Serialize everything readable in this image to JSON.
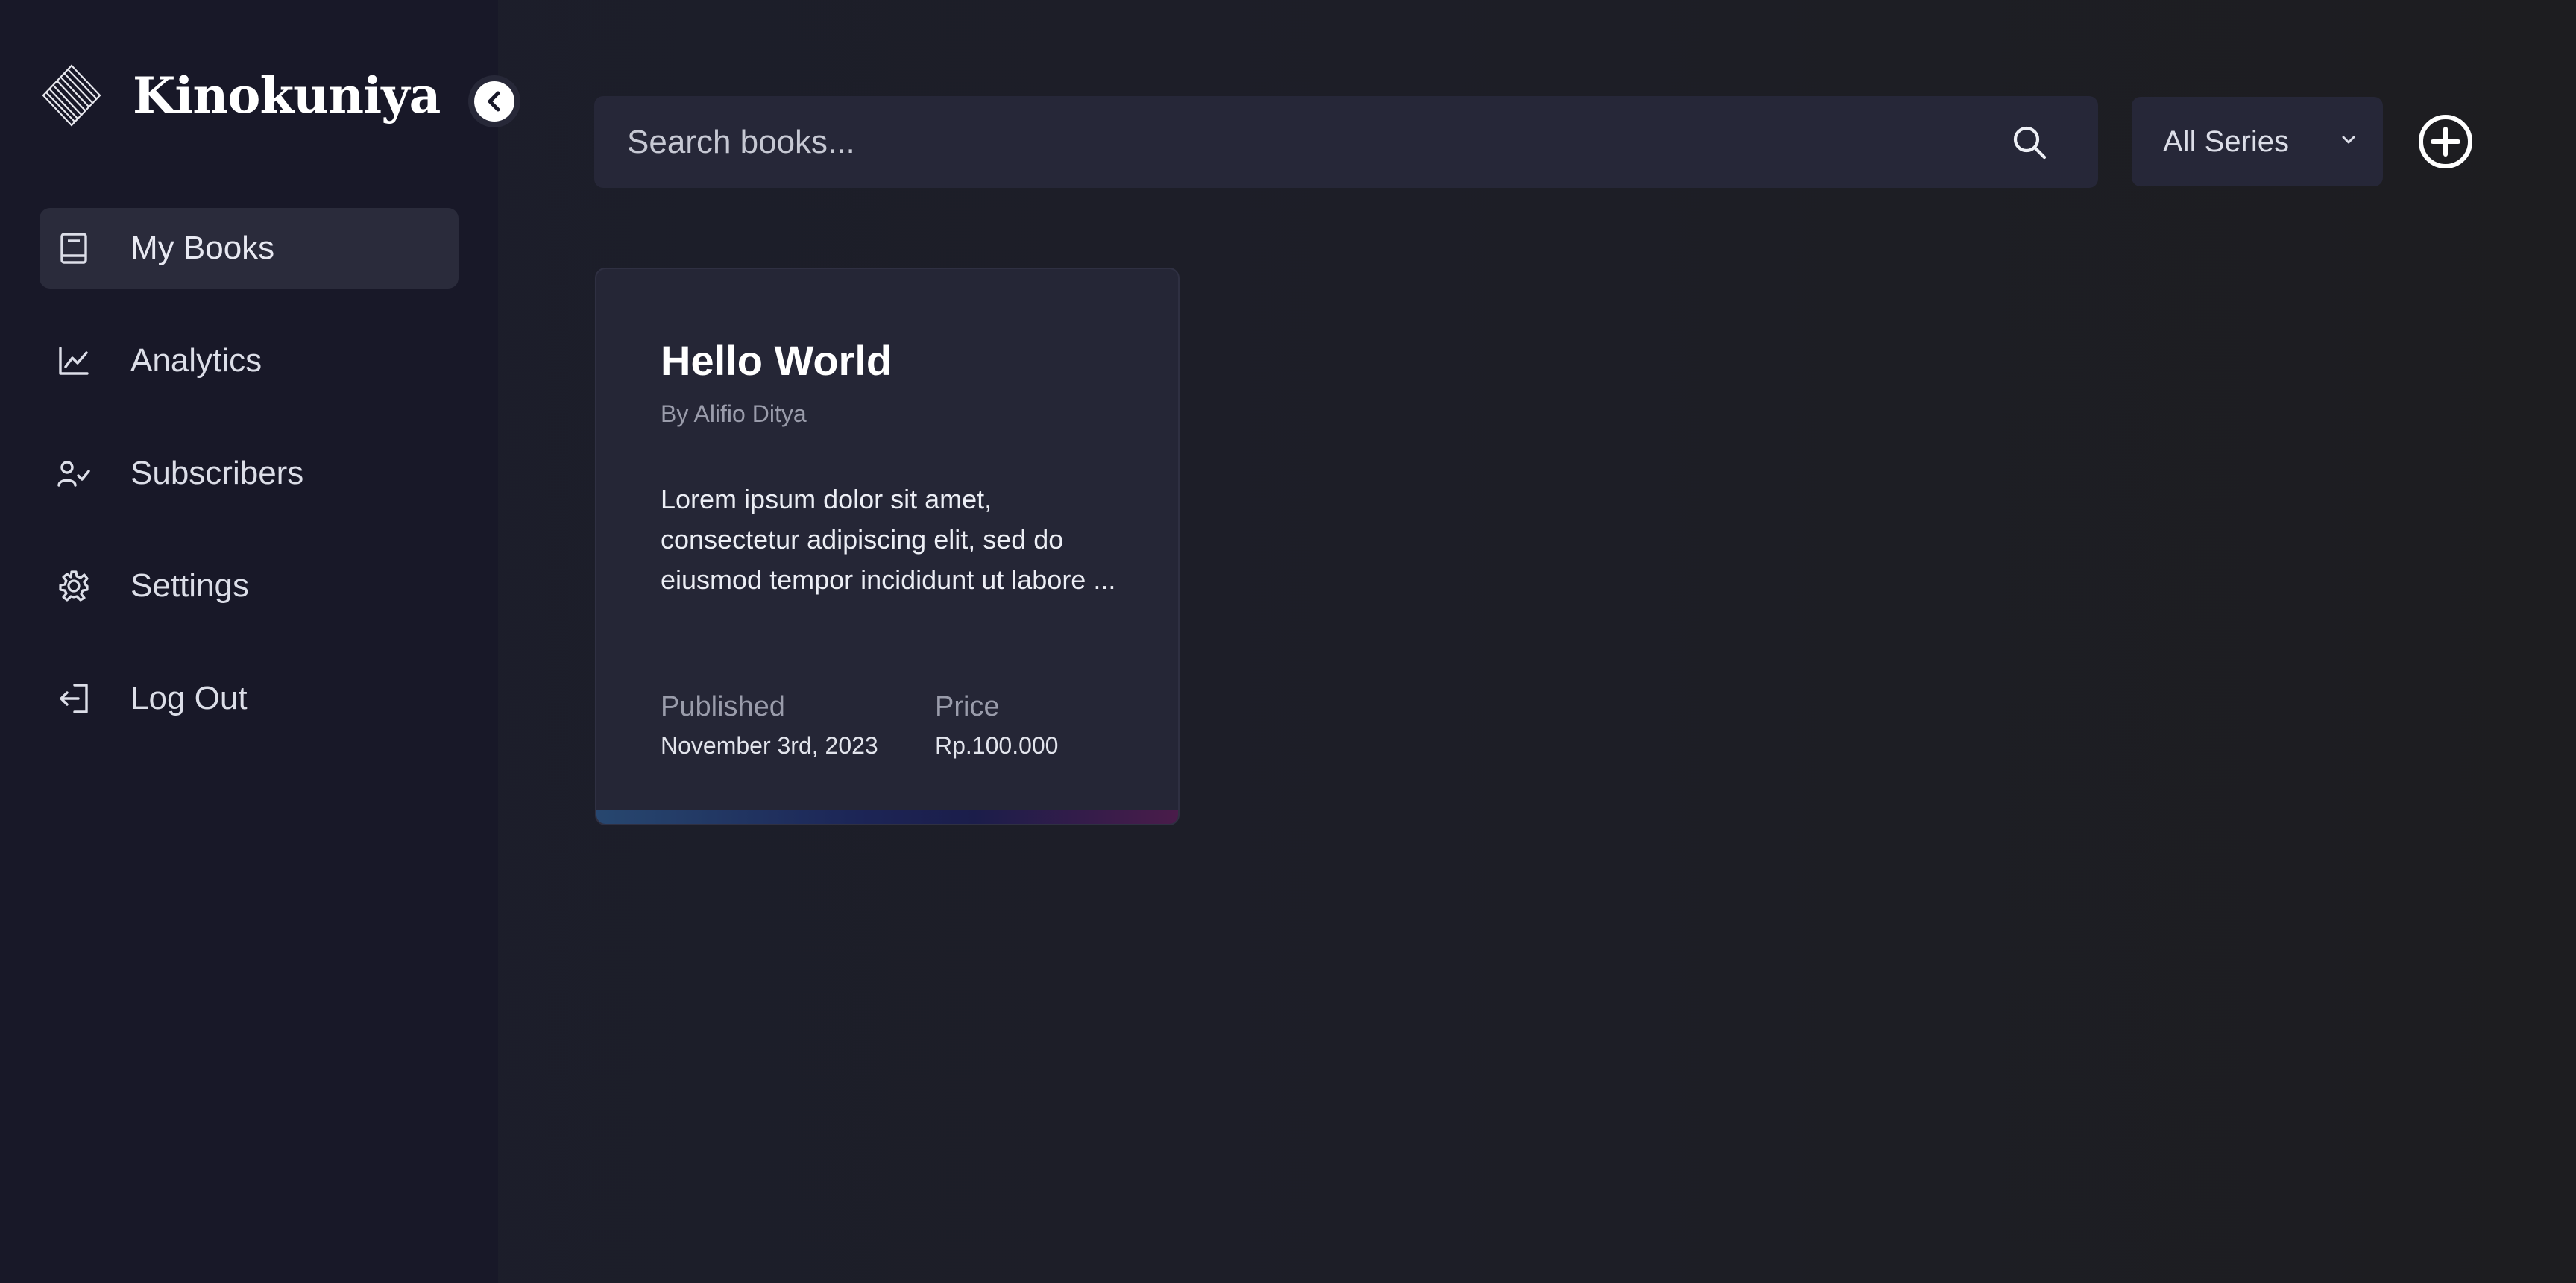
{
  "brand": {
    "name": "Kinokuniya",
    "logo_icon": "striped-diamond-logo"
  },
  "sidebar": {
    "collapse_icon": "chevron-left-icon",
    "items": [
      {
        "label": "My Books",
        "icon": "book-icon",
        "active": true
      },
      {
        "label": "Analytics",
        "icon": "line-chart-icon",
        "active": false
      },
      {
        "label": "Subscribers",
        "icon": "user-check-icon",
        "active": false
      },
      {
        "label": "Settings",
        "icon": "gear-icon",
        "active": false
      },
      {
        "label": "Log Out",
        "icon": "logout-icon",
        "active": false
      }
    ]
  },
  "toolbar": {
    "search_placeholder": "Search books...",
    "search_value": "",
    "series_selected": "All Series",
    "add_icon": "plus-circle-icon"
  },
  "books": [
    {
      "title": "Hello World",
      "author": "By Alifio Ditya",
      "description": "Lorem ipsum dolor sit amet, consectetur adipiscing elit, sed do eiusmod tempor incididunt ut labore ...",
      "published_label": "Published",
      "published_value": "November 3rd, 2023",
      "price_label": "Price",
      "price_value": "Rp.100.000"
    }
  ],
  "colors": {
    "background": "#1c1d2b",
    "sidebar": "#181828",
    "panel": "#262738",
    "accent_white": "#ffffff"
  }
}
